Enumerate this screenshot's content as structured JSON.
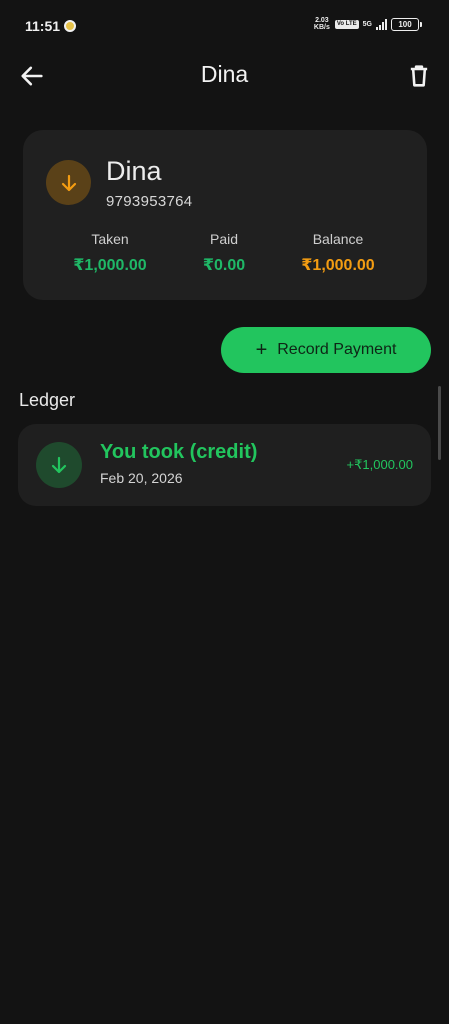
{
  "status_bar": {
    "time": "11:51",
    "net_speed_top": "2.03",
    "net_speed_bottom": "KB/s",
    "volte": "Vo LTE",
    "network": "5G",
    "battery": "100"
  },
  "app_bar": {
    "title": "Dina",
    "back_icon": "arrow-left-icon",
    "delete_icon": "trash-icon"
  },
  "contact": {
    "name": "Dina",
    "phone": "9793953764",
    "avatar_icon": "arrow-down-icon",
    "summary": {
      "taken_label": "Taken",
      "taken_value": "₹1,000.00",
      "paid_label": "Paid",
      "paid_value": "₹0.00",
      "balance_label": "Balance",
      "balance_value": "₹1,000.00"
    }
  },
  "actions": {
    "record_payment_label": "Record Payment",
    "record_payment_icon": "plus-icon"
  },
  "ledger": {
    "heading": "Ledger",
    "items": [
      {
        "title": "You took (credit)",
        "date": "Feb 20, 2026",
        "amount": "+₹1,000.00",
        "icon": "arrow-down-icon"
      }
    ]
  },
  "colors": {
    "background": "#131313",
    "card": "#202020",
    "green": "#22c55e",
    "orange": "#f39c12"
  }
}
